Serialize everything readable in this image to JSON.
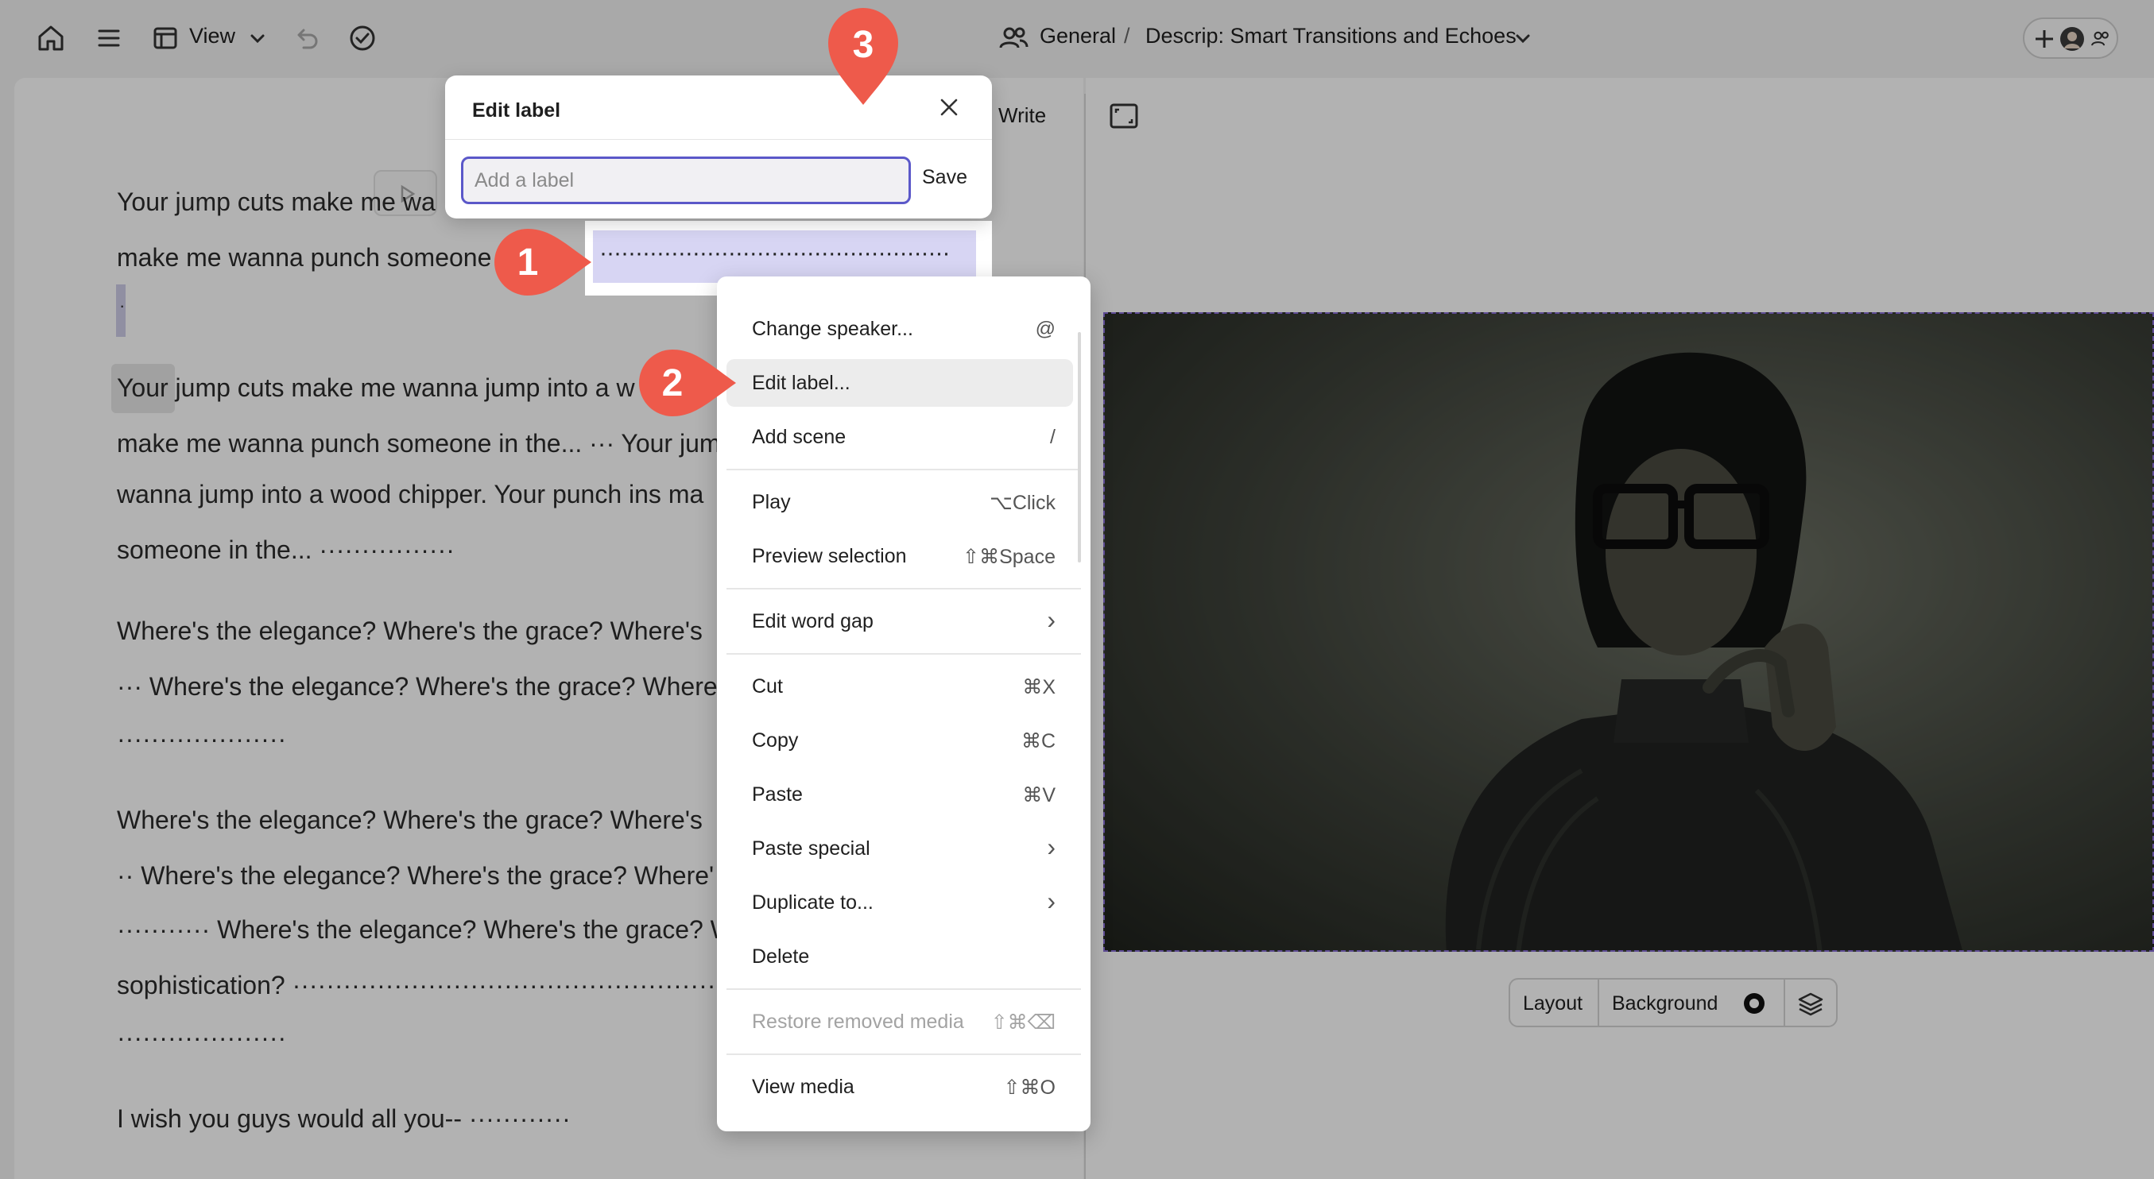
{
  "topbar": {
    "view_label": "View",
    "breadcrumb_workspace": "General",
    "breadcrumb_separator": "/",
    "project_title": "Descrip: Smart Transitions and Echoes"
  },
  "editor": {
    "write_label": "Write",
    "lines": [
      "Your jump cuts make me wa",
      "make me wanna punch someone",
      "·",
      "Your jump cuts make me wanna jump into a w",
      "make me wanna punch someone in the... ··· Your jum",
      "wanna jump into a wood chipper. Your punch ins ma",
      "someone in the... ················",
      "Where's the elegance? Where's the grace? Where's",
      "··· Where's the elegance? Where's the grace? Where",
      "····················",
      "Where's the elegance? Where's the grace? Where's",
      "·· Where's the elegance? Where's the grace? Where'",
      "··········· Where's the elegance? Where's the grace? W",
      "sophistication? ··················································",
      "····················",
      "I wish you guys would all you-- ············"
    ]
  },
  "edit_label_popover": {
    "title": "Edit label",
    "input_placeholder": "Add a label",
    "input_value": "",
    "save_label": "Save"
  },
  "selection_dots": "·················································",
  "context_menu": {
    "items": [
      {
        "label": "Change speaker...",
        "shortcut": "@"
      },
      {
        "label": "Edit label...",
        "shortcut": ""
      },
      {
        "label": "Add scene",
        "shortcut": "/"
      },
      {
        "label": "Play",
        "shortcut": "⌥Click"
      },
      {
        "label": "Preview selection",
        "shortcut": "⇧⌘Space"
      },
      {
        "label": "Edit word gap",
        "shortcut": "›"
      },
      {
        "label": "Cut",
        "shortcut": "⌘X"
      },
      {
        "label": "Copy",
        "shortcut": "⌘C"
      },
      {
        "label": "Paste",
        "shortcut": "⌘V"
      },
      {
        "label": "Paste special",
        "shortcut": "›"
      },
      {
        "label": "Duplicate to...",
        "shortcut": "›"
      },
      {
        "label": "Delete",
        "shortcut": ""
      },
      {
        "label": "Restore removed media",
        "shortcut": "⇧⌘⌫"
      },
      {
        "label": "View media",
        "shortcut": "⇧⌘O"
      }
    ]
  },
  "scene_toolbar": {
    "layout_label": "Layout",
    "background_label": "Background"
  },
  "annotations": {
    "badge_1": "1",
    "badge_2": "2",
    "badge_3": "3"
  },
  "colors": {
    "accent": "#5b58c9",
    "selection": "#d7d5f3",
    "badge": "#ee5a4b"
  }
}
